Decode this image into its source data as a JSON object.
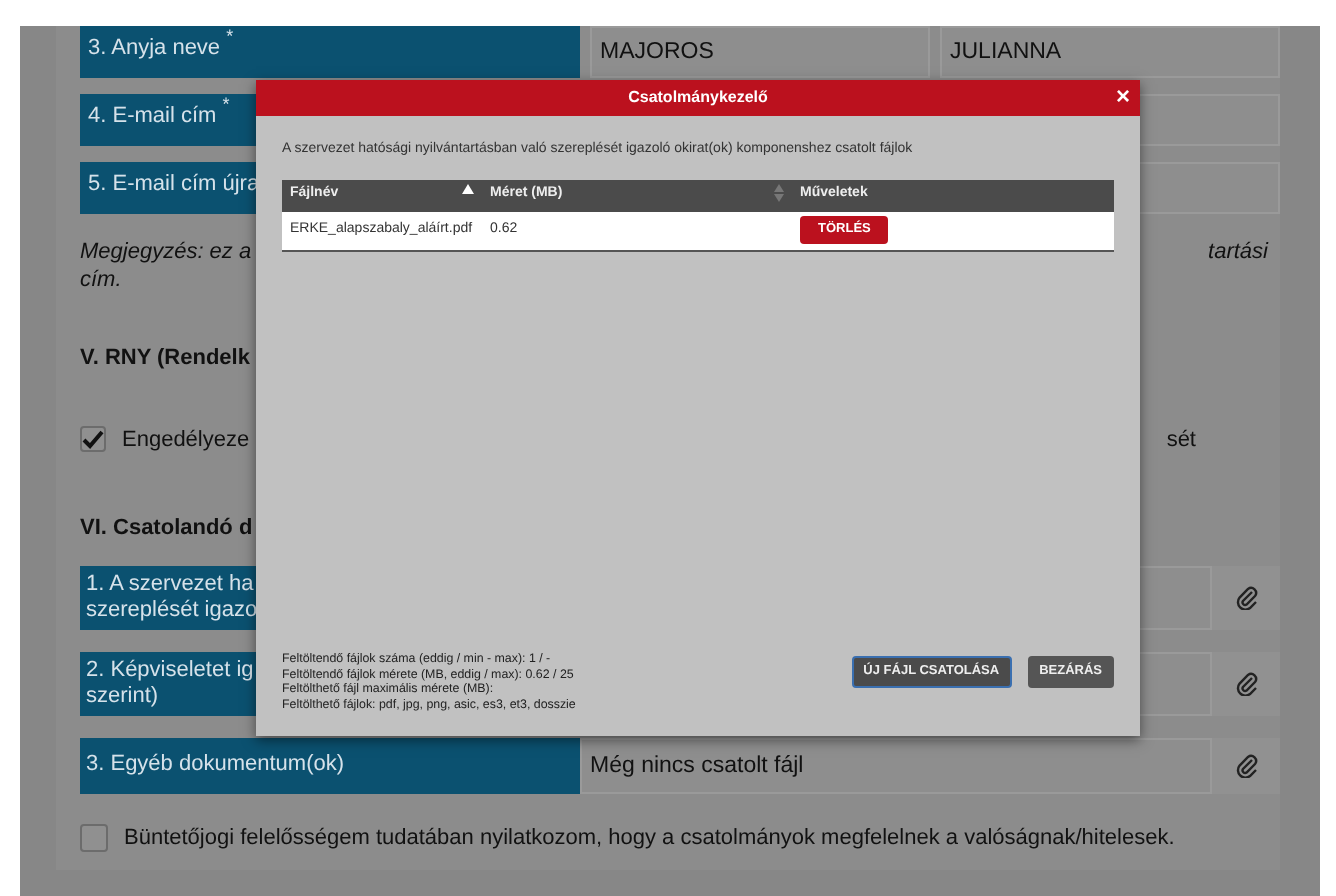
{
  "form": {
    "name_row": {
      "label": "3. Anyja neve",
      "mark": "*",
      "values": [
        "MAJOROS",
        "JULIANNA"
      ]
    },
    "email_rows": [
      {
        "label": "4. E-mail cím",
        "mark": "*"
      },
      {
        "label": "5. E-mail cím újra"
      }
    ],
    "note": {
      "lines": [
        "Megjegyzés: ez a",
        "cím."
      ],
      "right": "tartási"
    },
    "section_5": {
      "title": "V. RNY (Rendelk",
      "checkbox": {
        "label": "Engedélyeze",
        "label_tail": "sét",
        "checked": true
      }
    },
    "section_6": {
      "title": "VI. Csatolandó d",
      "attachments": [
        {
          "label_lines": [
            "1. A szervezet ha",
            "szereplését igazo"
          ]
        },
        {
          "label_lines": [
            "2. Képviseletet ig",
            "szerint)"
          ]
        },
        {
          "label_lines": [
            "3. Egyéb dokumentum(ok)"
          ],
          "value": "Még nincs csatolt fájl"
        }
      ]
    },
    "declaration": {
      "label": "Büntetőjogi felelősségem tudatában nyilatkozom, hogy a csatolmányok megfelelnek a valóságnak/hitelesek.",
      "checked": false
    }
  },
  "modal": {
    "title": "Csatolmánykezelő",
    "close": "×",
    "description": "A szervezet hatósági nyilvántartásban való szereplését igazoló okirat(ok) komponenshez csatolt fájlok",
    "table": {
      "columns": [
        {
          "label": "Fájlnév",
          "sortable": true,
          "sorted": true
        },
        {
          "label": "Méret (MB)",
          "sortable": true,
          "sorted": false
        },
        {
          "label": "Műveletek",
          "sortable": false
        }
      ],
      "rows": [
        {
          "file": "ERKE_alapszabaly_aláírt.pdf",
          "size": "0.62",
          "action": "TÖRLÉS"
        }
      ]
    },
    "info": [
      "Feltöltendő fájlok száma (eddig / min - max): 1 / -",
      "Feltöltendő fájlok mérete (MB, eddig / max): 0.62 / 25",
      "Feltölthető fájl maximális mérete (MB):",
      "Feltölthető fájlok: pdf, jpg, png, asic, es3, et3, dosszie"
    ],
    "buttons": [
      {
        "label": "ÚJ FÁJL CSATOLÁSA",
        "kind": "primary"
      },
      {
        "label": "BEZÁRÁS",
        "kind": "secondary"
      }
    ]
  }
}
